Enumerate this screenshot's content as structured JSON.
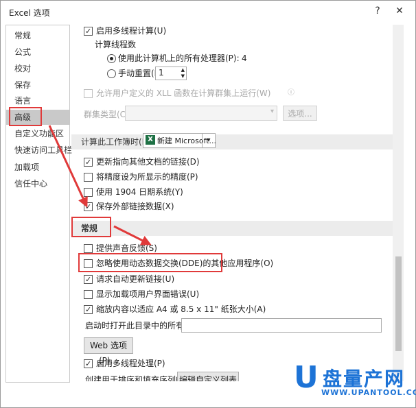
{
  "window": {
    "title": "Excel 选项",
    "help_glyph": "?",
    "close_glyph": "✕"
  },
  "sidebar": {
    "items": [
      {
        "label": "常规"
      },
      {
        "label": "公式"
      },
      {
        "label": "校对"
      },
      {
        "label": "保存"
      },
      {
        "label": "语言"
      },
      {
        "label": "高级",
        "selected": true
      },
      {
        "label": "自定义功能区"
      },
      {
        "label": "快速访问工具栏"
      },
      {
        "label": "加载项"
      },
      {
        "label": "信任中心"
      }
    ]
  },
  "formulas": {
    "multithread_label": "启用多线程计算(U)",
    "multithread_checked": true,
    "thread_count_heading": "计算线程数",
    "use_all_label": "使用此计算机上的所有处理器(P):",
    "use_all_value": "4",
    "use_all_selected": true,
    "manual_label": "手动重置(M)",
    "manual_value": "1",
    "xll_label": "允许用户定义的 XLL 函数在计算群集上运行(W)",
    "cluster_type_label": "群集类型(C):",
    "cluster_options_button": "选项..."
  },
  "workbook_calc": {
    "heading": "计算此工作簿时(H):",
    "workbook_name": "新建 Microsoft...",
    "items": [
      {
        "label": "更新指向其他文档的链接(D)",
        "checked": true
      },
      {
        "label": "将精度设为所显示的精度(P)",
        "checked": false
      },
      {
        "label": "使用 1904 日期系统(Y)",
        "checked": false
      },
      {
        "label": "保存外部链接数据(X)",
        "checked": true
      }
    ]
  },
  "general": {
    "heading": "常规",
    "items": [
      {
        "label": "提供声音反馈(S)",
        "checked": false
      },
      {
        "label": "忽略使用动态数据交换(DDE)的其他应用程序(O)",
        "checked": false
      },
      {
        "label": "请求自动更新链接(U)",
        "checked": true
      },
      {
        "label": "显示加载项用户界面错误(U)",
        "checked": false
      },
      {
        "label": "缩放内容以适应 A4 或 8.5 x 11\" 纸张大小(A)",
        "checked": true
      }
    ],
    "startup_label": "启动时打开此目录中的所有文件(L):",
    "startup_value": "",
    "web_options_button": "Web 选项(P)...",
    "multiprocess_label": "启用多线程处理(P)",
    "multiprocess_checked": true,
    "custom_lists_label": "创建用于排序和填充序列的列表:",
    "custom_lists_button": "编辑自定义列表(O)..."
  },
  "watermark": {
    "letter": "U",
    "text": "盘量产网",
    "url": "WWW.UPANTOOL.COM"
  },
  "colors": {
    "accent_red": "#e03a3a",
    "watermark_blue": "#1d73d6",
    "selected_nav": "#c9c9c9",
    "section_bg": "#ececec"
  }
}
